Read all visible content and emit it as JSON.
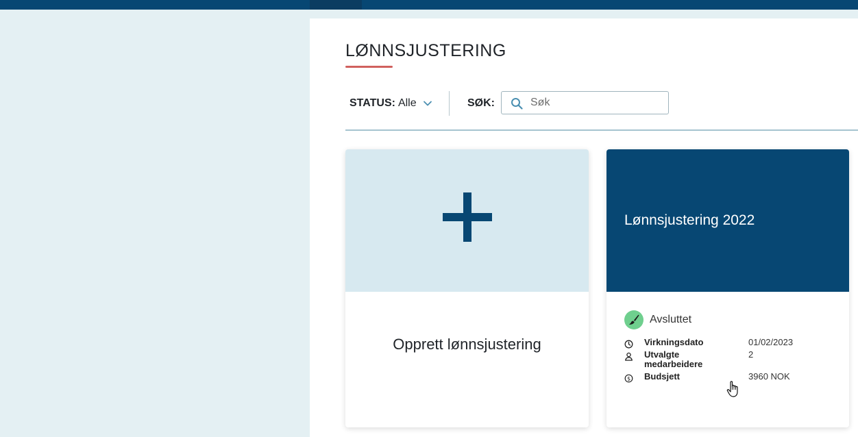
{
  "page": {
    "title": "LØNNSJUSTERING"
  },
  "filters": {
    "status_label": "STATUS:",
    "status_value": "Alle",
    "search_label": "SØK:",
    "search_placeholder": "Søk",
    "search_value": ""
  },
  "cards": {
    "new": {
      "label": "Opprett lønnsjustering",
      "icon": "plus-icon"
    },
    "adjustment": {
      "title": "Lønnsjustering 2022",
      "status": "Avsluttet",
      "status_icon": "brush-icon",
      "status_color": "#6fcf8e",
      "details": [
        {
          "icon": "clock-icon",
          "label": "Virkningsdato",
          "value": "01/02/2023"
        },
        {
          "icon": "person-icon",
          "label": "Utvalgte medarbeidere",
          "value": "2"
        },
        {
          "icon": "coin-icon",
          "label": "Budsjett",
          "value": "3960 NOK"
        }
      ]
    }
  },
  "colors": {
    "primary": "#074773",
    "accent": "#d0605e",
    "background": "#e4f0f3",
    "new_card_top": "#d7e9f0"
  }
}
